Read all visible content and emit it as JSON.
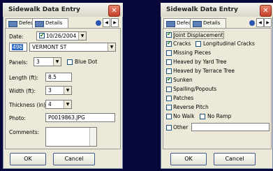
{
  "left_window": {
    "title": "Sidewalk Data Entry",
    "tabs": [
      "Defects",
      "Details"
    ],
    "date_label": "Date:",
    "date_value": "10/26/2004",
    "house_number": "496",
    "street": "VERMONT ST",
    "panels_label": "Panels:",
    "panels_value": "3",
    "blue_dot_label": "Blue Dot",
    "length_label": "Length (ft):",
    "length_value": "8.5",
    "width_label": "Width (ft):",
    "width_value": "3",
    "thickness_label": "Thickness (in):",
    "thickness_value": "4",
    "photo_label": "Photo:",
    "photo_value": "P0019863.JPG",
    "comments_label": "Comments:",
    "ok_label": "OK",
    "cancel_label": "Cancel"
  },
  "right_window": {
    "title": "Sidewalk Data Entry",
    "tabs": [
      "Defects",
      "Details"
    ],
    "checks": [
      {
        "label": "Joint Displacement",
        "checked": true
      },
      {
        "label": "Cracks",
        "checked": true
      },
      {
        "label": "Longitudinal Cracks",
        "checked": false
      },
      {
        "label": "Missing Pieces",
        "checked": false
      },
      {
        "label": "Heaved by Yard Tree",
        "checked": false
      },
      {
        "label": "Heaved by Terrace Tree",
        "checked": false
      },
      {
        "label": "Sunken",
        "checked": true
      },
      {
        "label": "Spalling/Popouts",
        "checked": false
      },
      {
        "label": "Patches",
        "checked": false
      },
      {
        "label": "Reverse Pitch",
        "checked": false
      },
      {
        "label": "No Walk",
        "checked": false
      },
      {
        "label": "No Ramp",
        "checked": false
      },
      {
        "label": "Other",
        "checked": false
      }
    ],
    "ok_label": "OK",
    "cancel_label": "Cancel"
  }
}
